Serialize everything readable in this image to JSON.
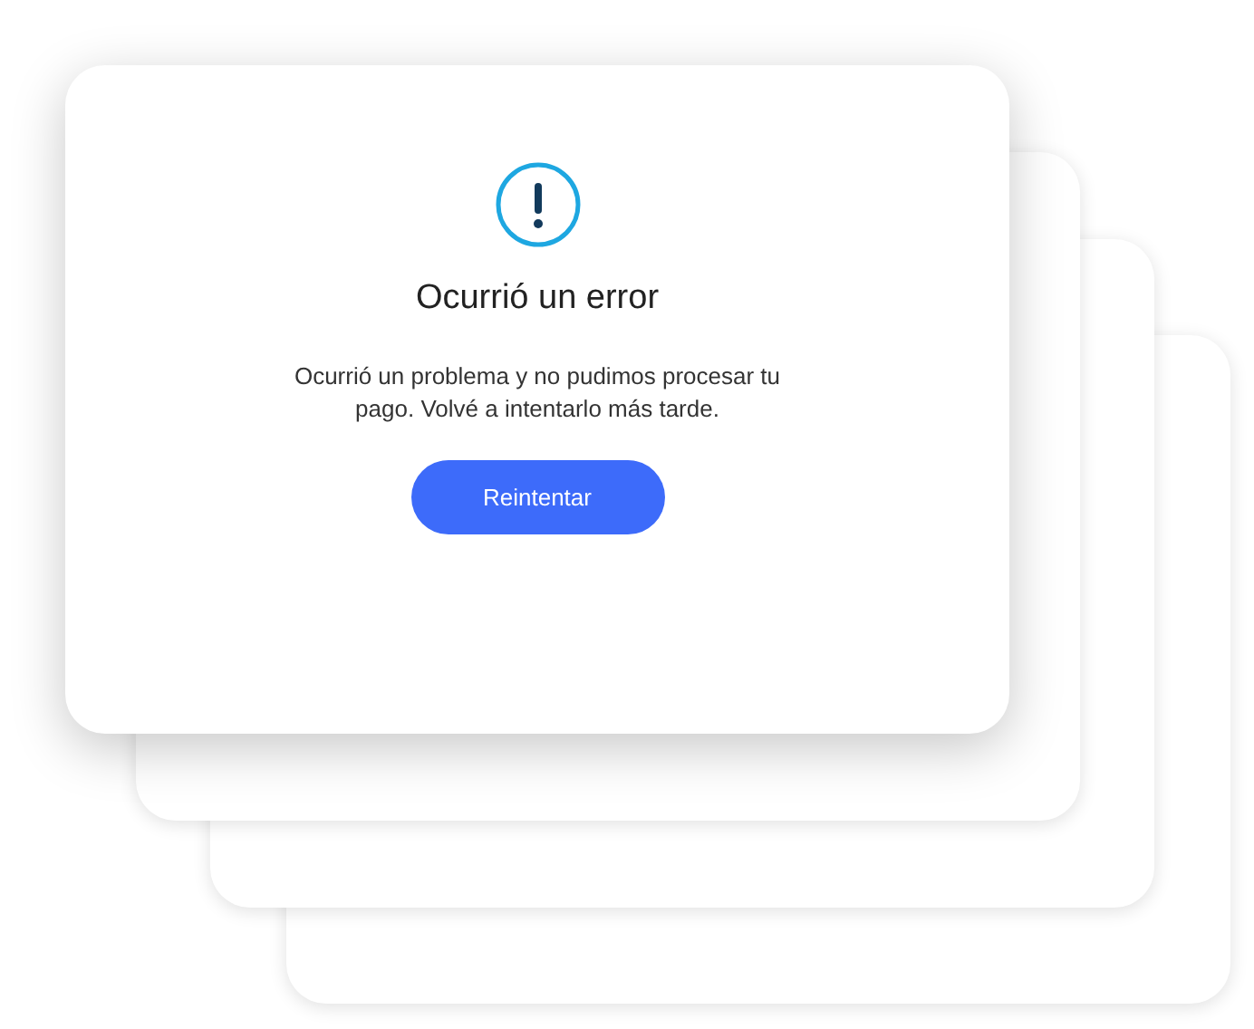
{
  "dialog": {
    "title": "Ocurrió un error",
    "message": "Ocurrió un problema y no pudimos procesar tu pago. Volvé a intentarlo más tarde.",
    "button": "Reintentar"
  }
}
